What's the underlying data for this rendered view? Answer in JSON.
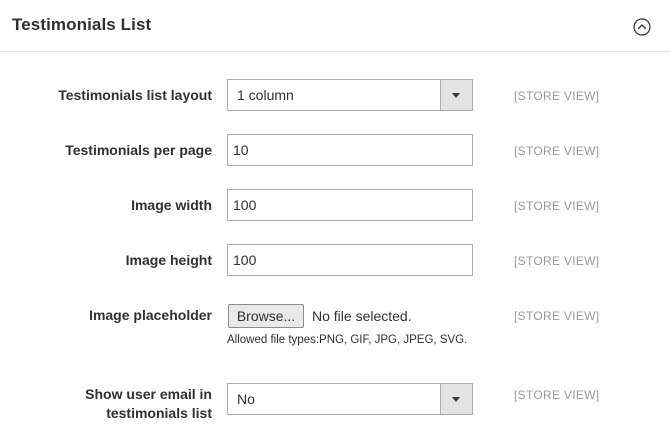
{
  "section": {
    "title": "Testimonials List"
  },
  "fields": {
    "layout": {
      "label": "Testimonials list layout",
      "value": "1 column",
      "scope": "[STORE VIEW]"
    },
    "per_page": {
      "label": "Testimonials per page",
      "value": "10",
      "scope": "[STORE VIEW]"
    },
    "image_width": {
      "label": "Image width",
      "value": "100",
      "scope": "[STORE VIEW]"
    },
    "image_height": {
      "label": "Image height",
      "value": "100",
      "scope": "[STORE VIEW]"
    },
    "image_placeholder": {
      "label": "Image placeholder",
      "button_label": "Browse...",
      "file_status": "No file selected.",
      "note": "Allowed file types:PNG, GIF, JPG, JPEG, SVG.",
      "scope": "[STORE VIEW]"
    },
    "show_email": {
      "label_line1": "Show user email in",
      "label_line2": "testimonials list",
      "value": "No",
      "scope": "[STORE VIEW]"
    }
  },
  "icons": {
    "collapse": "chevron-up-circle-icon",
    "dropdown": "triangle-down-icon"
  }
}
